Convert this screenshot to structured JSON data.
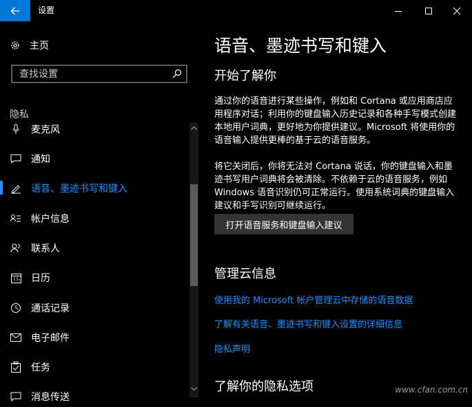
{
  "window": {
    "title": "设置"
  },
  "sidebar": {
    "home_label": "主页",
    "search_placeholder": "查找设置",
    "section_label": "隐私",
    "items": [
      {
        "label": "麦克风",
        "icon": "microphone-icon"
      },
      {
        "label": "通知",
        "icon": "notification-icon"
      },
      {
        "label": "语音、墨迹书写和键入",
        "icon": "speech-inking-icon",
        "selected": true
      },
      {
        "label": "帐户信息",
        "icon": "account-info-icon"
      },
      {
        "label": "联系人",
        "icon": "contacts-icon"
      },
      {
        "label": "日历",
        "icon": "calendar-icon"
      },
      {
        "label": "通话记录",
        "icon": "call-history-icon"
      },
      {
        "label": "电子邮件",
        "icon": "email-icon"
      },
      {
        "label": "任务",
        "icon": "tasks-icon"
      },
      {
        "label": "消息传送",
        "icon": "messaging-icon"
      }
    ]
  },
  "main": {
    "title": "语音、墨迹书写和键入",
    "section1_heading": "开始了解你",
    "para1": "通过你的语音进行某些操作，例如和 Cortana 或应用商店应用程序对话；利用你的键盘输入历史记录和各种手写模式创建本地用户词典，更好地为你提供建议。Microsoft 将使用你的语音输入提供更棒的基于云的语音服务。",
    "para2": "将它关闭后，你将无法对 Cortana 说话，你的键盘输入和墨迹书写用户词典将会被清除。不依赖于云的语音服务，例如 Windows 语音识别仍可正常运行。使用系统词典的键盘输入建议和手写识别可继续运行。",
    "button_label": "打开语音服务和键盘输入建议",
    "section2_heading": "管理云信息",
    "links": [
      "使用我的 Microsoft 帐户管理云中存储的语音数据",
      "了解有关语音、墨迹书写和键入设置的详细信息",
      "隐私声明"
    ],
    "section3_heading": "了解你的隐私选项"
  },
  "watermark": "www.cfan.com.cn",
  "colors": {
    "accent": "#0078d7",
    "link": "#1e90ff",
    "background": "#000000",
    "button": "#333333"
  }
}
